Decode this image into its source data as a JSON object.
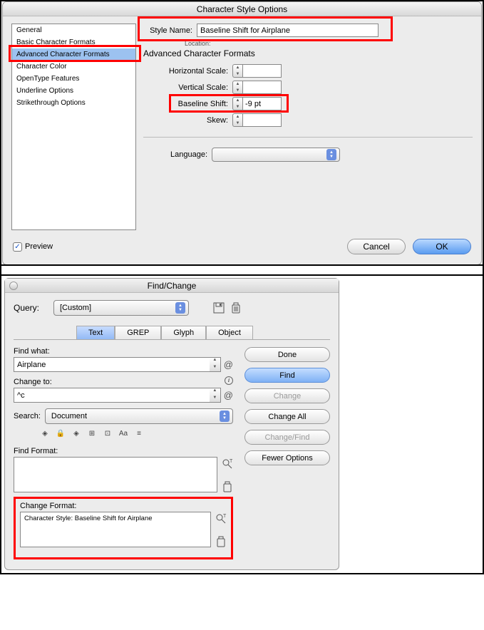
{
  "dlg1": {
    "title": "Character Style Options",
    "sidebar": [
      "General",
      "Basic Character Formats",
      "Advanced Character Formats",
      "Character Color",
      "OpenType Features",
      "Underline Options",
      "Strikethrough Options"
    ],
    "selected_index": 2,
    "style_name_label": "Style Name:",
    "style_name_value": "Baseline Shift for Airplane",
    "location_label": "Location:",
    "section_title": "Advanced Character Formats",
    "fields": {
      "h_scale": "Horizontal Scale:",
      "v_scale": "Vertical Scale:",
      "baseline": "Baseline Shift:",
      "baseline_value": "-9 pt",
      "skew": "Skew:"
    },
    "language_label": "Language:",
    "preview_label": "Preview",
    "cancel": "Cancel",
    "ok": "OK"
  },
  "dlg2": {
    "title": "Find/Change",
    "query_label": "Query:",
    "query_value": "[Custom]",
    "tabs": [
      "Text",
      "GREP",
      "Glyph",
      "Object"
    ],
    "selected_tab": 0,
    "find_what_label": "Find what:",
    "find_what_value": "Airplane",
    "change_to_label": "Change to:",
    "change_to_value": "^c",
    "search_label": "Search:",
    "search_value": "Document",
    "find_format_label": "Find Format:",
    "change_format_label": "Change Format:",
    "change_format_value": "Character Style: Baseline Shift for Airplane",
    "buttons": {
      "done": "Done",
      "find": "Find",
      "change": "Change",
      "change_all": "Change All",
      "change_find": "Change/Find",
      "fewer": "Fewer Options"
    }
  }
}
